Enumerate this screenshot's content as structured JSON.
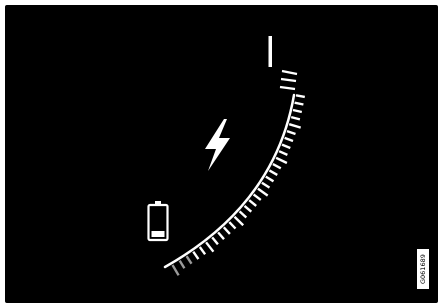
{
  "gauge": {
    "label": "battery-charge-gauge",
    "segments_total": 30,
    "segments_filled": 3,
    "tick_color": "#ffffff",
    "filled_color": "#9a9a9a",
    "accent": "#ffffff",
    "background": "#000000"
  },
  "icons": {
    "battery": "battery-icon",
    "bolt": "lightning-bolt-icon",
    "max_marker": "full-charge-marker-icon"
  },
  "battery_level": 0.2,
  "ref_code": "G061689"
}
